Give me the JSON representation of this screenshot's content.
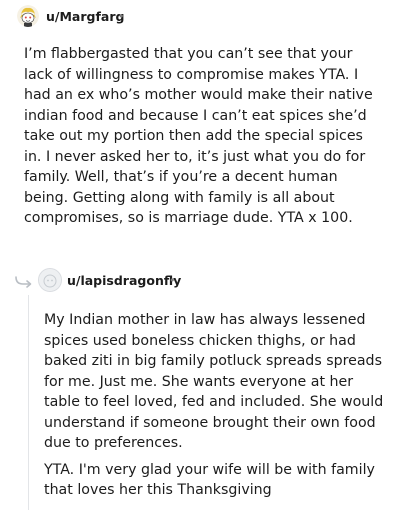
{
  "comments": [
    {
      "username": "u/Margfarg",
      "separator": "•",
      "avatar": "snoo-avatar-icon",
      "body": "I’m flabbergasted that you can’t see that your lack of willingness to compromise makes YTA. I had an ex who’s mother would make their native indian food and because I can’t eat spices she’d take out my portion then add the special spices in. I never asked her to, it’s just what you do for family. Well, that’s if you’re a decent human being. Getting along with family is all about compromises, so is marriage dude. YTA x 100."
    },
    {
      "username": "u/lapisdragonfly",
      "separator": "•",
      "avatar": "default-avatar-icon",
      "paragraphs": [
        "My Indian mother in law has always lessened spices used boneless chicken thighs, or had baked ziti in big family potluck spreads spreads for me. Just me. She wants everyone at her table to feel loved, fed and included. She would understand if someone brought their own food due to preferences.",
        "YTA. I'm very glad your wife will be with family that loves her this Thanksgiving"
      ]
    }
  ],
  "colors": {
    "text": "#1c1c1c",
    "meta": "#7c7c7c",
    "thread_line": "#e3e5e8"
  }
}
